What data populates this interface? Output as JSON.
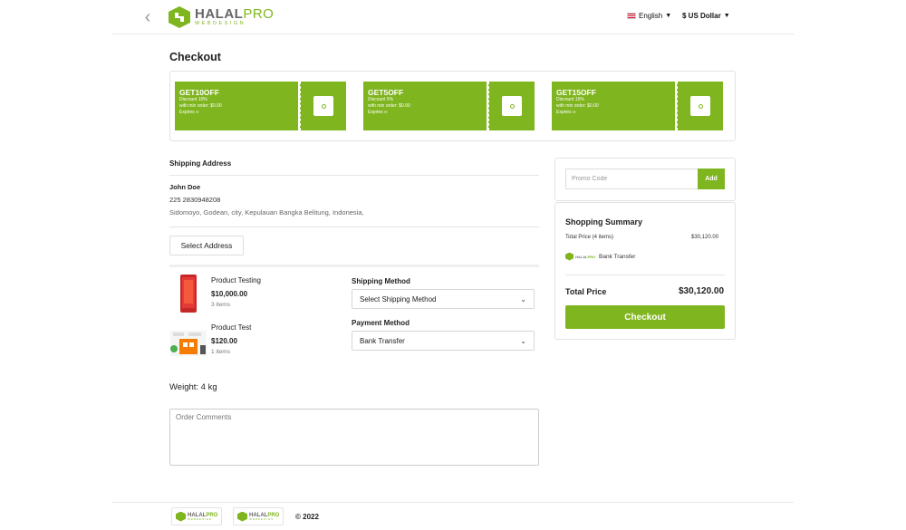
{
  "header": {
    "brand_main": "HALAL",
    "brand_accent": "PRO",
    "brand_tagline": "WEBDESIGN",
    "language": "English",
    "currency": "$ US Dollar"
  },
  "page_title": "Checkout",
  "coupons": [
    {
      "code": "GET10OFF",
      "discount": "Discount 10%",
      "min_order": "with min order: $0.00",
      "expires": "Expires ∞"
    },
    {
      "code": "GET5OFF",
      "discount": "Discount 5%",
      "min_order": "with min order: $0.00",
      "expires": "Expires ∞"
    },
    {
      "code": "GET15OFF",
      "discount": "Discount 15%",
      "min_order": "with min order: $0.00",
      "expires": "Expires ∞"
    }
  ],
  "shipping": {
    "title": "Shipping Address",
    "name": "John Doe",
    "phone": "225 2830948208",
    "address": "Sidomoyo, Godean, city, Kepulauan Bangka Belitung, Indonesia,",
    "select_button": "Select Address"
  },
  "products": [
    {
      "name": "Product Testing",
      "price": "$10,000.00",
      "qty": "3 items"
    },
    {
      "name": "Product Test",
      "price": "$120.00",
      "qty": "1 items"
    }
  ],
  "shipping_method": {
    "label": "Shipping Method",
    "value": "Select Shipping Method"
  },
  "payment_method": {
    "label": "Payment Method",
    "value": "Bank Transfer"
  },
  "weight": "Weight: 4 kg",
  "comments_placeholder": "Order Comments",
  "promo": {
    "placeholder": "Promo Code",
    "button": "Add"
  },
  "summary": {
    "title": "Shopping Summary",
    "total_price_label": "Total Price (4 items)",
    "total_price_value": "$30,120.00",
    "payment": "Bank Transfer",
    "grand_label": "Total Price",
    "grand_value": "$30,120.00",
    "checkout_button": "Checkout"
  },
  "footer": {
    "copyright": "© 2022"
  },
  "colors": {
    "accent": "#7fb51f"
  }
}
